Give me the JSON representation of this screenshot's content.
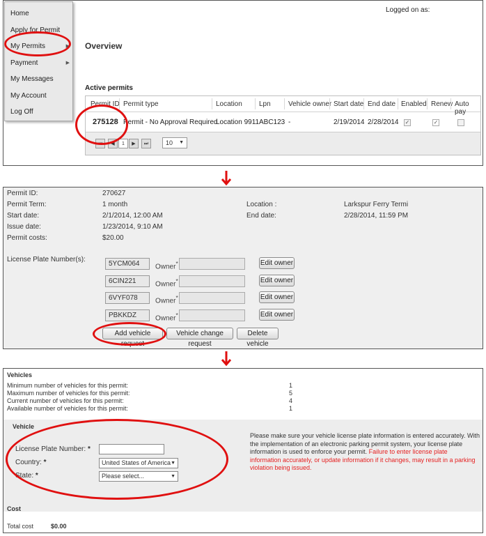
{
  "menu": {
    "items": [
      {
        "label": "Home",
        "submenu": false
      },
      {
        "label": "Apply for Permit",
        "submenu": false
      },
      {
        "label": "My Permits",
        "submenu": true
      },
      {
        "label": "Payment",
        "submenu": true
      },
      {
        "label": "My Messages",
        "submenu": false
      },
      {
        "label": "My Account",
        "submenu": false
      },
      {
        "label": "Log Off",
        "submenu": false
      }
    ]
  },
  "header": {
    "logged_on": "Logged on as:"
  },
  "overview": {
    "title": "Overview"
  },
  "active_permits": {
    "title": "Active permits",
    "columns": [
      "Permit ID",
      "Permit type",
      "Location",
      "Lpn",
      "Vehicle owner",
      "Start date",
      "End date",
      "Enabled",
      "Renew",
      "Auto pay"
    ],
    "row": {
      "permit_id": "275128",
      "permit_type": "Permit - No Approval Required",
      "location": "Location 9911",
      "lpn": "ABC123",
      "vehicle_owner": "-",
      "start_date": "2/19/2014",
      "end_date": "2/28/2014",
      "enabled": true,
      "renew": true,
      "auto_pay": false
    },
    "pager": {
      "page": "1",
      "page_size": "10"
    }
  },
  "permit_detail": {
    "permit_id_label": "Permit ID:",
    "permit_id": "270627",
    "term_label": "Permit Term:",
    "term": "1 month",
    "start_label": "Start date:",
    "start": "2/1/2014, 12:00 AM",
    "issue_label": "Issue date:",
    "issue": "1/23/2014, 9:10 AM",
    "cost_label": "Permit costs:",
    "cost": "$20.00",
    "location_label": "Location :",
    "location": "Larkspur Ferry Termi",
    "end_label": "End date:",
    "end": "2/28/2014, 11:59 PM",
    "plates_label": "License Plate Number(s):",
    "plates": [
      "5YCM064",
      "6CIN221",
      "6VYF078",
      "PBKKDZ"
    ],
    "owner_label": "Owner",
    "edit_owner": "Edit owner",
    "add_vehicle": "Add vehicle request",
    "vehicle_change": "Vehicle change request",
    "delete_vehicle": "Delete vehicle"
  },
  "vehicles": {
    "title": "Vehicles",
    "stats": [
      {
        "label": "Minimum number of vehicles for this permit:",
        "value": "1"
      },
      {
        "label": "Maximum number of vehicles for this permit:",
        "value": "5"
      },
      {
        "label": "Current number of vehicles for this permit:",
        "value": "4"
      },
      {
        "label": "Available number of vehicles for this permit:",
        "value": "1"
      }
    ],
    "form": {
      "title": "Vehicle",
      "plate_label": "License Plate Number:",
      "plate_value": "",
      "country_label": "Country:",
      "country_value": "United States of America",
      "state_label": "State:",
      "state_value": "Please select...",
      "required_mark": "*"
    },
    "notice_normal": "Please make sure your vehicle license plate information is entered accurately. With the implementation of an electronic parking permit system, your license plate information is used to enforce your permit.",
    "notice_warning": "Failure to enter license plate information accurately, or update information if it changes, may result in a parking violation being issued.",
    "cost_title": "Cost",
    "total_label": "Total cost",
    "total_value": "$0.00"
  },
  "colors": {
    "highlight": "#e01010",
    "warning_text": "#e52020"
  }
}
